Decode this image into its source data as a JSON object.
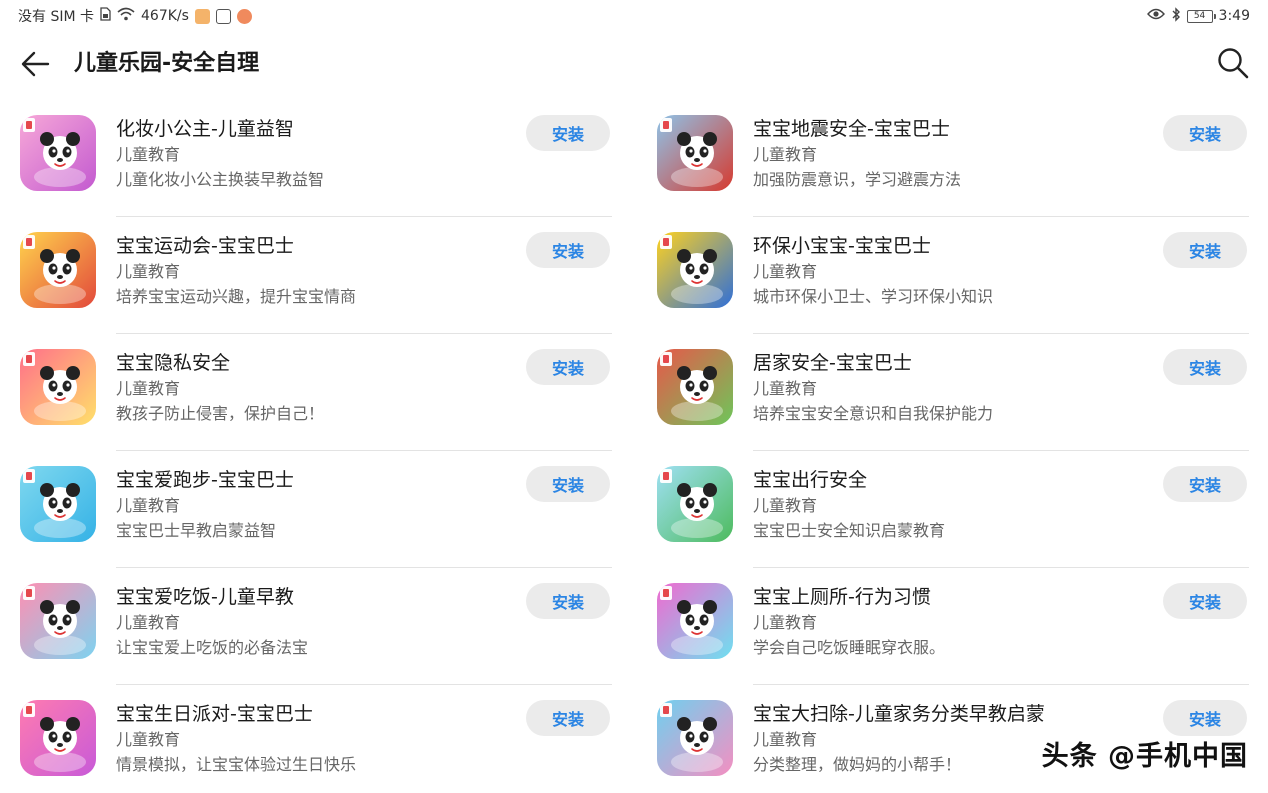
{
  "status_bar": {
    "carrier": "没有 SIM 卡",
    "speed": "467K/s",
    "battery": "54",
    "time": "3:49"
  },
  "header": {
    "title": "儿童乐园-安全自理"
  },
  "apps": [
    {
      "name": "化妆小公主-儿童益智",
      "category": "儿童教育",
      "desc": "儿童化妆小公主换装早教益智",
      "install": "安装",
      "icon_colors": [
        "#f7a8d8",
        "#c35ad0"
      ]
    },
    {
      "name": "宝宝地震安全-宝宝巴士",
      "category": "儿童教育",
      "desc": "加强防震意识，学习避震方法",
      "install": "安装",
      "icon_colors": [
        "#8ec3e8",
        "#d63a2f"
      ]
    },
    {
      "name": "宝宝运动会-宝宝巴士",
      "category": "儿童教育",
      "desc": "培养宝宝运动兴趣，提升宝宝情商",
      "install": "安装",
      "icon_colors": [
        "#ffd34d",
        "#e2483b"
      ]
    },
    {
      "name": "环保小宝宝-宝宝巴士",
      "category": "儿童教育",
      "desc": "城市环保小卫士、学习环保小知识",
      "install": "安装",
      "icon_colors": [
        "#ffd21f",
        "#2f6fd8"
      ]
    },
    {
      "name": "宝宝隐私安全",
      "category": "儿童教育",
      "desc": "教孩子防止侵害，保护自己！",
      "install": "安装",
      "icon_colors": [
        "#ff6f8a",
        "#ffe06a"
      ]
    },
    {
      "name": "居家安全-宝宝巴士",
      "category": "儿童教育",
      "desc": "培养宝宝安全意识和自我保护能力",
      "install": "安装",
      "icon_colors": [
        "#e8574a",
        "#6ec65a"
      ]
    },
    {
      "name": "宝宝爱跑步-宝宝巴士",
      "category": "儿童教育",
      "desc": "宝宝巴士早教启蒙益智",
      "install": "安装",
      "icon_colors": [
        "#7fd8ef",
        "#35b2e6"
      ]
    },
    {
      "name": "宝宝出行安全",
      "category": "儿童教育",
      "desc": "宝宝巴士安全知识启蒙教育",
      "install": "安装",
      "icon_colors": [
        "#9fe0f4",
        "#4dbb5d"
      ]
    },
    {
      "name": "宝宝爱吃饭-儿童早教",
      "category": "儿童教育",
      "desc": "让宝宝爱上吃饭的必备法宝",
      "install": "安装",
      "icon_colors": [
        "#ff8fb2",
        "#7dd3f0"
      ]
    },
    {
      "name": "宝宝上厕所-行为习惯",
      "category": "儿童教育",
      "desc": "学会自己吃饭睡眠穿衣服。",
      "install": "安装",
      "icon_colors": [
        "#f06ad0",
        "#6ee0f0"
      ]
    },
    {
      "name": "宝宝生日派对-宝宝巴士",
      "category": "儿童教育",
      "desc": "情景模拟，让宝宝体验过生日快乐",
      "install": "安装",
      "icon_colors": [
        "#ff7bb0",
        "#c85ad8"
      ]
    },
    {
      "name": "宝宝大扫除-儿童家务分类早教启蒙",
      "category": "儿童教育",
      "desc": "分类整理，做妈妈的小帮手！",
      "install": "安装",
      "icon_colors": [
        "#6fd0ef",
        "#f48fc1"
      ]
    }
  ],
  "watermark": "头条 @手机中国",
  "icons": {
    "back": "arrow-left-icon",
    "search": "search-icon",
    "wifi": "wifi-icon",
    "eye": "eye-icon",
    "bluetooth": "bluetooth-icon"
  },
  "colors": {
    "install_text": "#2b85e4",
    "install_bg": "#ebebeb"
  }
}
